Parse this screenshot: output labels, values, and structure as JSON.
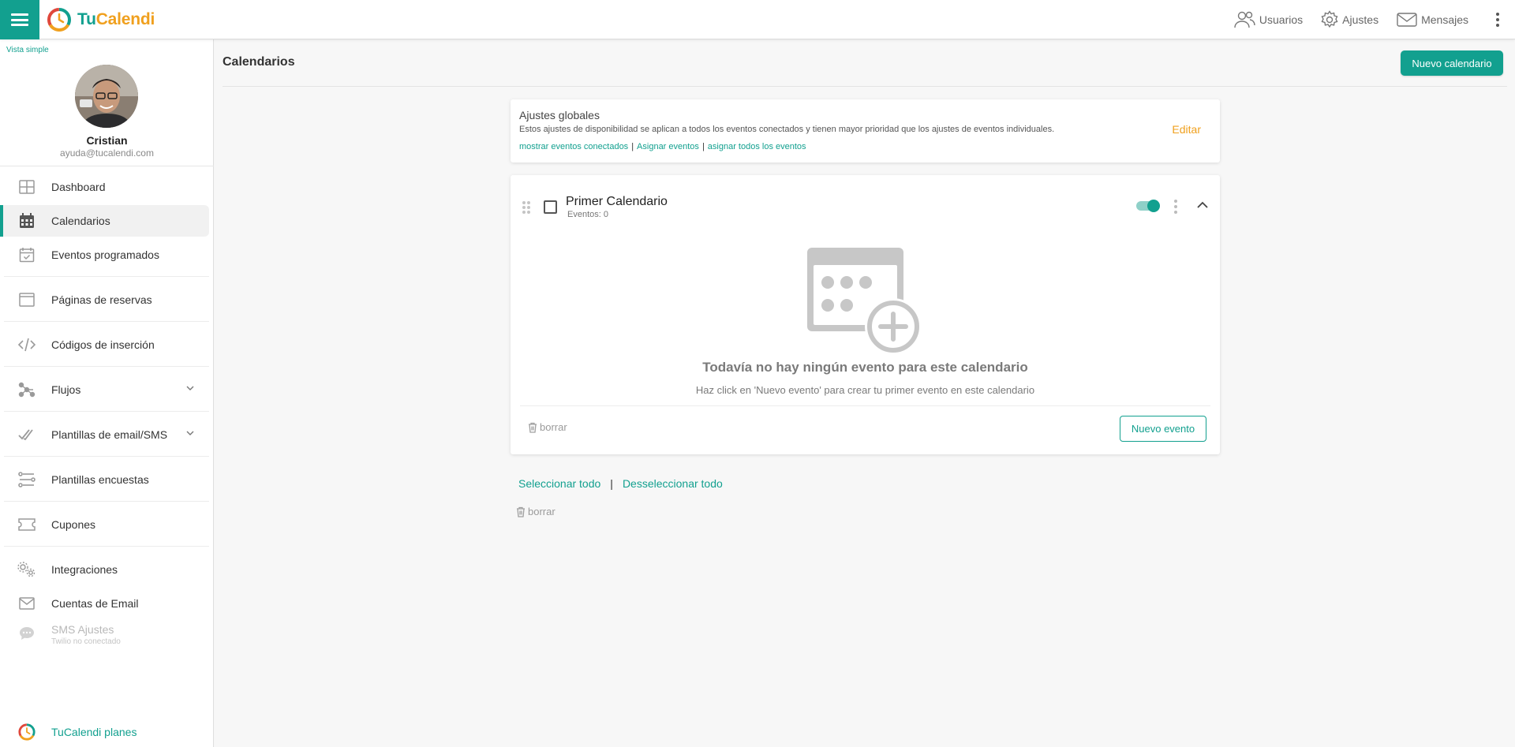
{
  "app": {
    "logo_tu": "Tu",
    "logo_cal": "Calendi",
    "accent_color": "#12a08f",
    "brand_orange": "#f0a01e"
  },
  "topbar": {
    "users_label": "Usuarios",
    "settings_label": "Ajustes",
    "messages_label": "Mensajes"
  },
  "sidebar": {
    "vista_simple": "Vista simple",
    "user_name": "Cristian",
    "user_email": "ayuda@tucalendi.com",
    "items": [
      {
        "label": "Dashboard",
        "icon": "dashboard-icon"
      },
      {
        "label": "Calendarios",
        "icon": "calendar-icon",
        "active": true
      },
      {
        "label": "Eventos programados",
        "icon": "calendar-check-icon"
      },
      {
        "label": "Páginas de reservas",
        "icon": "browser-window-icon"
      },
      {
        "label": "Códigos de inserción",
        "icon": "code-icon"
      },
      {
        "label": "Flujos",
        "icon": "workflow-icon"
      },
      {
        "label": "Plantillas de email/SMS",
        "icon": "double-check-icon"
      },
      {
        "label": "Plantillas encuestas",
        "icon": "survey-icon"
      },
      {
        "label": "Cupones",
        "icon": "coupon-icon"
      },
      {
        "label": "Integraciones",
        "icon": "gears-icon"
      },
      {
        "label": "Cuentas de Email",
        "icon": "envelope-icon"
      },
      {
        "label": "SMS Ajustes",
        "icon": "chat-icon",
        "sub": "Twilio no conectado",
        "disabled": true
      }
    ],
    "plans_label": "TuCalendi planes"
  },
  "main": {
    "title": "Calendarios",
    "new_calendar_button": "Nuevo calendario",
    "global_settings": {
      "title": "Ajustes globales",
      "description": "Estos ajustes de disponibilidad se aplican a todos los eventos conectados y tienen mayor prioridad que los ajustes de eventos individuales.",
      "links": [
        "mostrar eventos conectados",
        "Asignar eventos",
        "asignar todos los eventos"
      ],
      "separator": "|",
      "edit_label": "Editar"
    },
    "calendar": {
      "name": "Primer Calendario",
      "events_count": "Eventos: 0",
      "enabled": true,
      "empty_title": "Todavía no hay ningún evento para este calendario",
      "empty_subtitle": "Haz click en 'Nuevo evento' para crear tu primer evento en este calendario",
      "delete_label": "borrar",
      "new_event_button": "Nuevo evento"
    },
    "select_all": "Seleccionar todo",
    "deselect_all": "Desseleccionar todo",
    "separator": "|",
    "bulk_delete_label": "borrar"
  }
}
